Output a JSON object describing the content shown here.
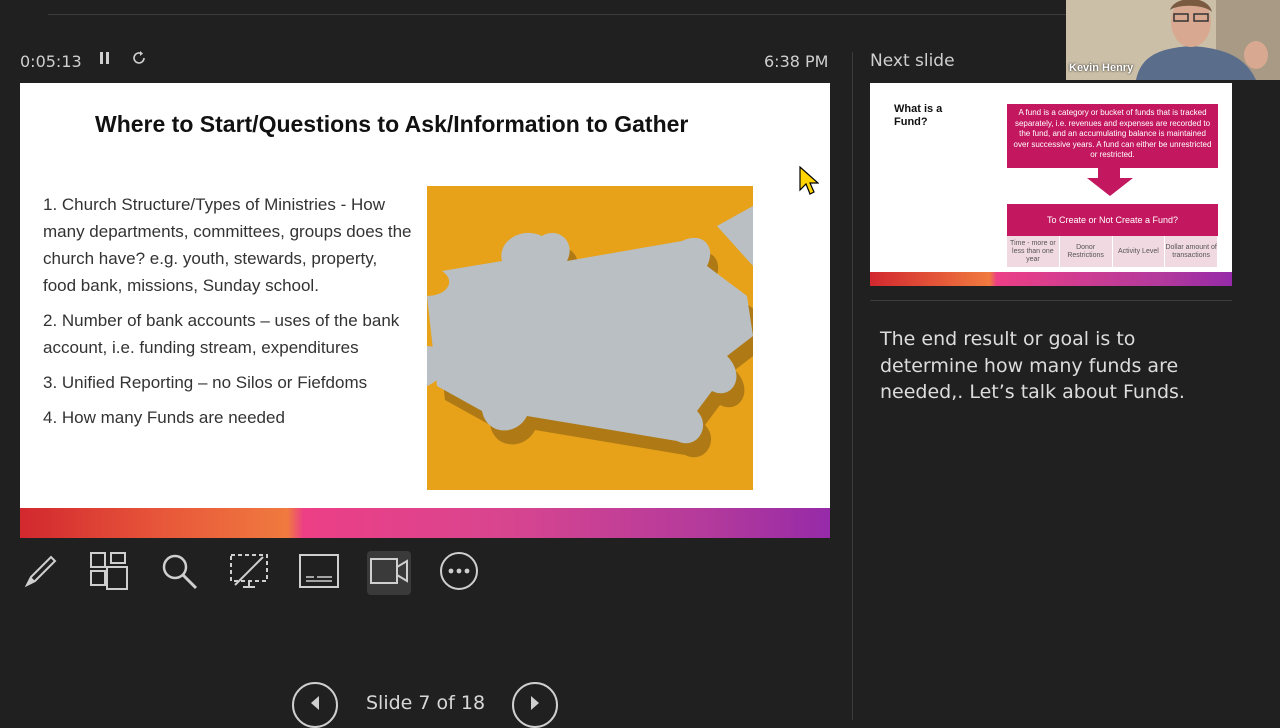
{
  "presenter": {
    "timer": "0:05:13",
    "clock": "6:38 PM",
    "pause_icon": "pause-icon",
    "restart_icon": "restart-icon"
  },
  "current_slide": {
    "title": "Where to Start/Questions to Ask/Information to Gather",
    "items": [
      "1. Church Structure/Types of Ministries - How many departments, committees, groups does the church have? e.g. youth, stewards, property, food bank, missions, Sunday school.",
      "2. Number of bank accounts – uses of the bank account, i.e. funding stream, expenditures",
      "3. Unified Reporting – no Silos or Fiefdoms",
      "4. How many Funds are needed"
    ],
    "image": "puzzle-pieces-image"
  },
  "toolbar": {
    "tools": [
      "pen-icon",
      "slides-grid-icon",
      "zoom-icon",
      "laser-pointer-icon",
      "subtitles-icon",
      "camera-icon",
      "more-options-icon"
    ]
  },
  "navigation": {
    "counter": "Slide 7 of 18",
    "prev_icon": "previous-slide-icon",
    "next_icon": "next-slide-icon"
  },
  "next_slide": {
    "label": "Next slide",
    "title": "What is a Fund?",
    "definition": "A fund is a category or bucket of funds that is tracked separately, i.e. revenues and expenses are recorded to the fund, and an accumulating balance is maintained over successive years. A fund can either be unrestricted or restricted.",
    "decision": "To Create or Not Create a Fund?",
    "criteria": [
      "Time - more or less than one year",
      "Donor Restrictions",
      "Activity Level",
      "Dollar amount of transactions"
    ]
  },
  "notes": {
    "text": "The end result or goal is to determine how many funds are needed,. Let’s talk about Funds."
  },
  "webcam": {
    "name": "Kevin Henry"
  },
  "colors": {
    "background": "#202020",
    "accent_magenta": "#c3185f",
    "puzzle_background": "#e7a21a"
  }
}
